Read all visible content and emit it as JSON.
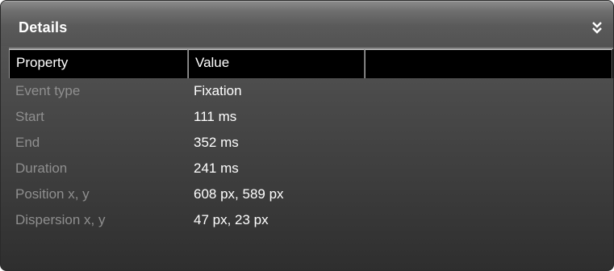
{
  "panel": {
    "title": "Details",
    "collapse_icon": "double-chevron-down-icon"
  },
  "table": {
    "columns": [
      "Property",
      "Value",
      ""
    ],
    "rows": [
      {
        "property": "Event type",
        "value": "Fixation"
      },
      {
        "property": "Start",
        "value": "111 ms"
      },
      {
        "property": "End",
        "value": "352 ms"
      },
      {
        "property": "Duration",
        "value": "241 ms"
      },
      {
        "property": "Position x, y",
        "value": "608 px, 589 px"
      },
      {
        "property": "Dispersion x, y",
        "value": "47 px, 23 px"
      }
    ]
  },
  "colors": {
    "panel_background": "#4a4a4a",
    "header_background": "#5a5a5a",
    "table_header_background": "#000000",
    "property_text": "#8f8f8f",
    "value_text": "#ffffff"
  }
}
